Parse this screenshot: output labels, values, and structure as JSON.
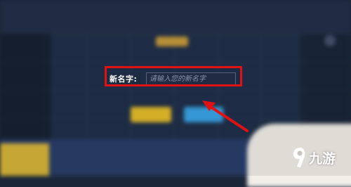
{
  "dialog": {
    "label": "新名字:",
    "input_placeholder": "请输入您的新名字",
    "input_value": ""
  },
  "watermark": {
    "text": "九游",
    "icon": "nine-game-logo-icon"
  },
  "colors": {
    "highlight": "#e21212",
    "arrow": "#e21212",
    "confirm_button": "#e6bd2b",
    "cancel_button": "#3aa4e6",
    "background": "#1b2638"
  }
}
